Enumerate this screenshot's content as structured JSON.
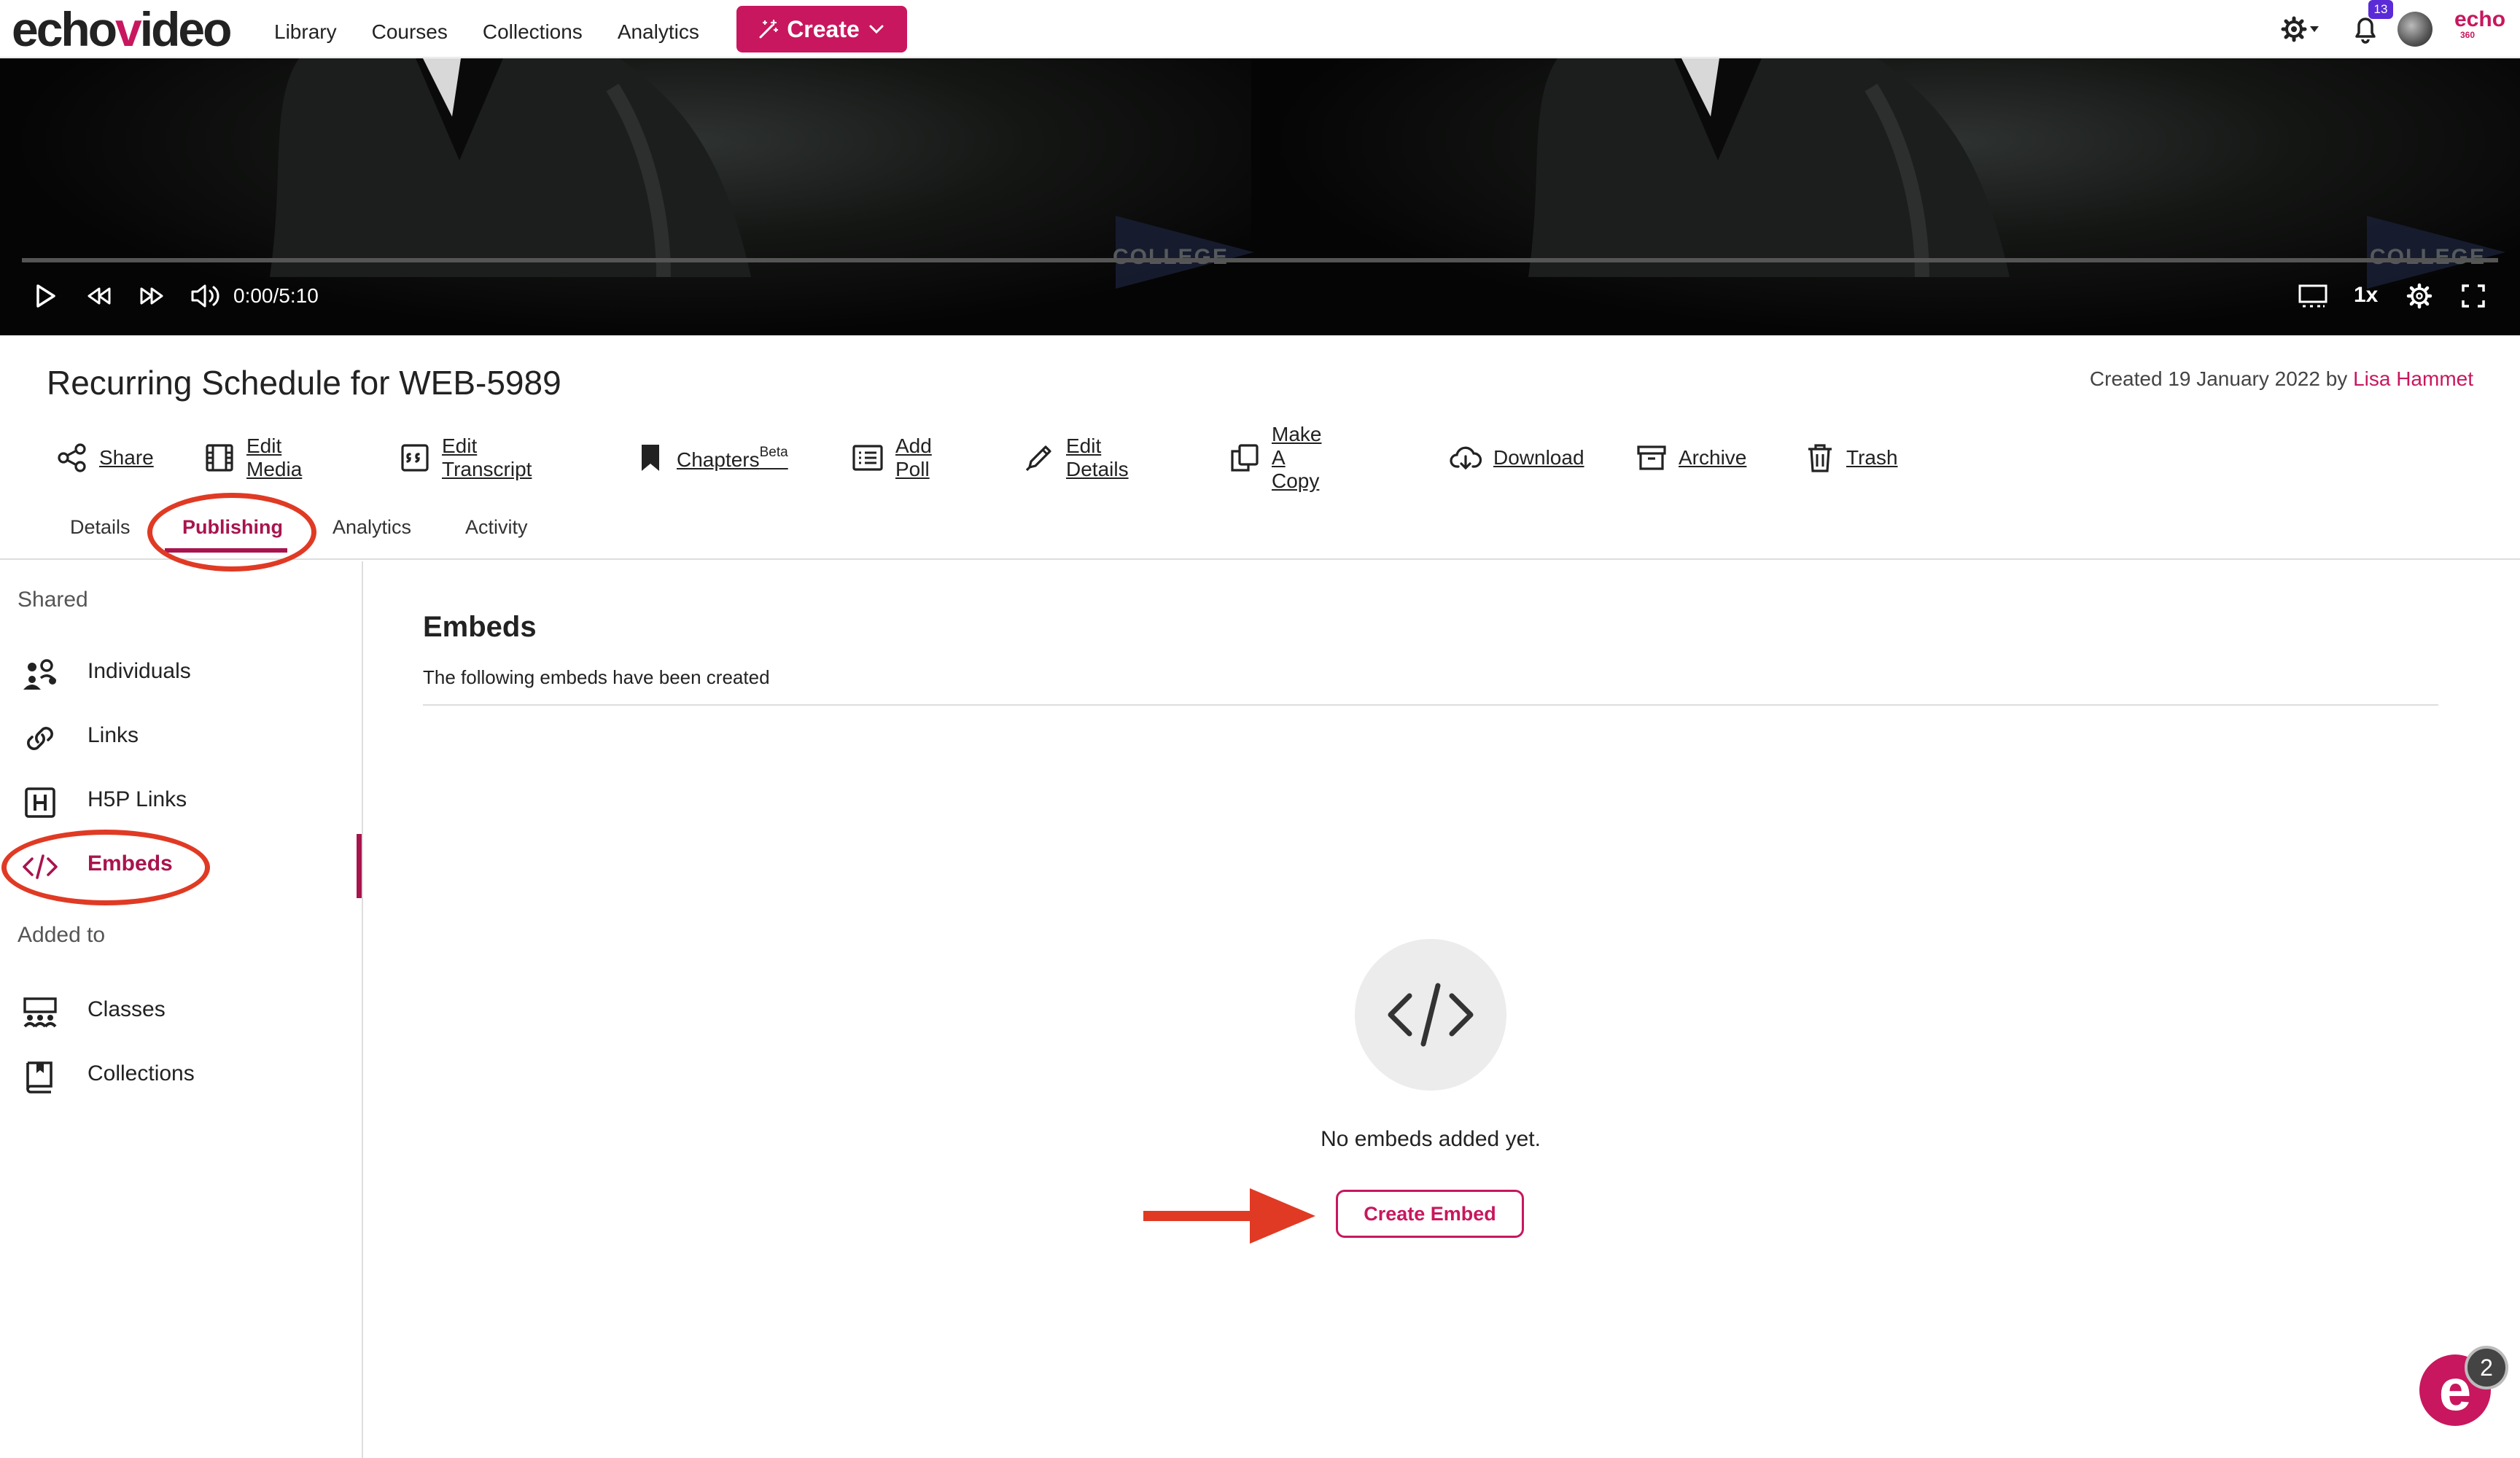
{
  "brand": {
    "logo_left": "echo",
    "logo_v": "v",
    "logo_right": "ideo",
    "accent": "#c8175e",
    "annotation": "#e03a24"
  },
  "nav": {
    "links": [
      "Library",
      "Courses",
      "Collections",
      "Analytics"
    ],
    "create_label": "Create",
    "notifications_count": "13",
    "partner_logo": "echo",
    "partner_sub": "360"
  },
  "player": {
    "time": "0:00/5:10",
    "speed": "1x",
    "watermark": "COLLEGE",
    "progress": 0
  },
  "media": {
    "title": "Recurring Schedule for WEB-5989",
    "created_prefix": "Created 19 January 2022 by",
    "author": "Lisa Hammet"
  },
  "actions": [
    {
      "label": "Share",
      "icon": "share-icon"
    },
    {
      "label": "Edit Media",
      "icon": "film-icon"
    },
    {
      "label": "Edit Transcript",
      "icon": "transcript-icon"
    },
    {
      "label": "Chapters",
      "sup": "Beta",
      "icon": "bookmark-icon"
    },
    {
      "label": "Add Poll",
      "icon": "poll-icon"
    },
    {
      "label": "Edit Details",
      "icon": "pencil-icon"
    },
    {
      "label": "Make A Copy",
      "icon": "copy-icon"
    },
    {
      "label": "Download",
      "icon": "cloud-download-icon"
    },
    {
      "label": "Archive",
      "icon": "archive-icon"
    },
    {
      "label": "Trash",
      "icon": "trash-icon"
    }
  ],
  "tabs": [
    {
      "label": "Details"
    },
    {
      "label": "Publishing",
      "active": true
    },
    {
      "label": "Analytics"
    },
    {
      "label": "Activity"
    }
  ],
  "sidebar": {
    "shared_heading": "Shared",
    "shared_items": [
      {
        "label": "Individuals",
        "icon": "users-icon"
      },
      {
        "label": "Links",
        "icon": "link-icon"
      },
      {
        "label": "H5P Links",
        "icon": "h5p-icon"
      },
      {
        "label": "Embeds",
        "icon": "code-icon",
        "active": true
      }
    ],
    "added_heading": "Added to",
    "added_items": [
      {
        "label": "Classes",
        "icon": "classes-icon"
      },
      {
        "label": "Collections",
        "icon": "collection-book-icon"
      }
    ]
  },
  "main": {
    "title": "Embeds",
    "subtitle": "The following embeds have been created",
    "empty_text": "No embeds added yet.",
    "create_button": "Create Embed"
  },
  "help": {
    "letter": "e",
    "badge": "2"
  }
}
